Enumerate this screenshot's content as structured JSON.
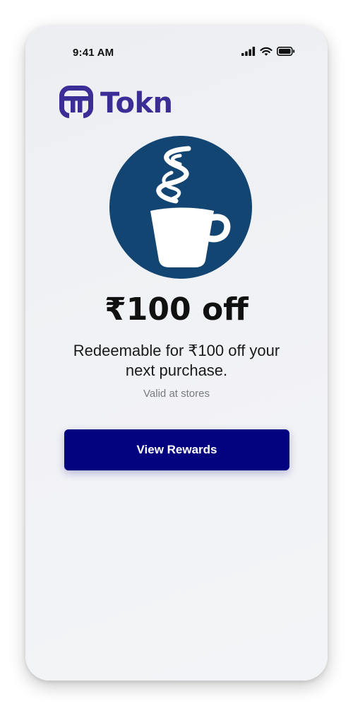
{
  "status_bar": {
    "time": "9:41 AM",
    "icons": [
      "cellular-signal-icon",
      "wifi-icon",
      "battery-icon"
    ]
  },
  "brand": {
    "name": "Tokn",
    "logo_icon": "tokn-logo-icon",
    "color": "#3b2d96"
  },
  "offer": {
    "illustration": "coffee-cup-icon",
    "illustration_bg": "#134573",
    "title": "₹100 off",
    "description": "Redeemable for ₹100 off your next purchase.",
    "validity": "Valid at stores"
  },
  "actions": {
    "view_rewards_label": "View Rewards",
    "button_color": "#04037f"
  }
}
